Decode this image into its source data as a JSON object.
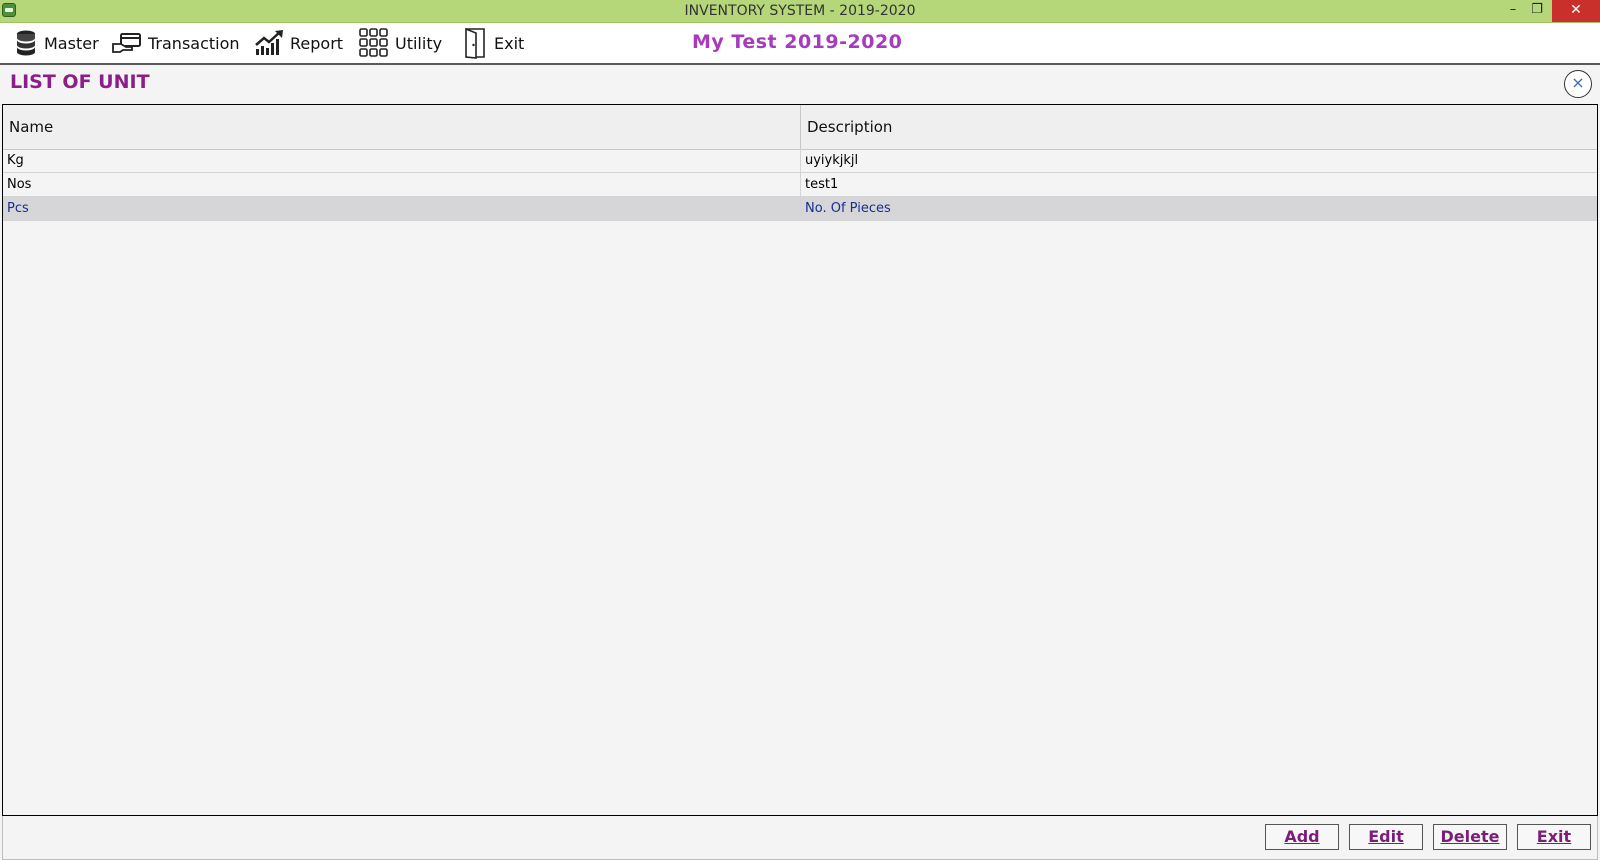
{
  "window": {
    "title": "INVENTORY SYSTEM - 2019-2020",
    "minimize": "–",
    "restore": "❐",
    "close": "✕"
  },
  "menu": {
    "items": [
      {
        "label": "Master",
        "icon": "database-icon"
      },
      {
        "label": "Transaction",
        "icon": "hand-card-icon"
      },
      {
        "label": "Report",
        "icon": "rising-chart-icon"
      },
      {
        "label": "Utility",
        "icon": "grid-apps-icon"
      },
      {
        "label": "Exit",
        "icon": "door-exit-icon"
      }
    ],
    "company": "My Test 2019-2020"
  },
  "panel": {
    "title": "LIST OF UNIT",
    "close": "×"
  },
  "table": {
    "columns": [
      "Name",
      "Description"
    ],
    "rows": [
      {
        "name": "Kg",
        "description": "uyiykjkjl",
        "selected": false
      },
      {
        "name": "Nos",
        "description": "test1",
        "selected": false
      },
      {
        "name": "Pcs",
        "description": "No. Of Pieces",
        "selected": true
      }
    ]
  },
  "buttons": {
    "add": "Add",
    "edit": "Edit",
    "delete": "Delete",
    "exit": "Exit"
  },
  "colors": {
    "titlebar": "#b5d77a",
    "company": "#a63bbd",
    "panel_title": "#8b1e8b",
    "selected_row": "#d6d6d8",
    "selected_text": "#1a2d8f"
  }
}
